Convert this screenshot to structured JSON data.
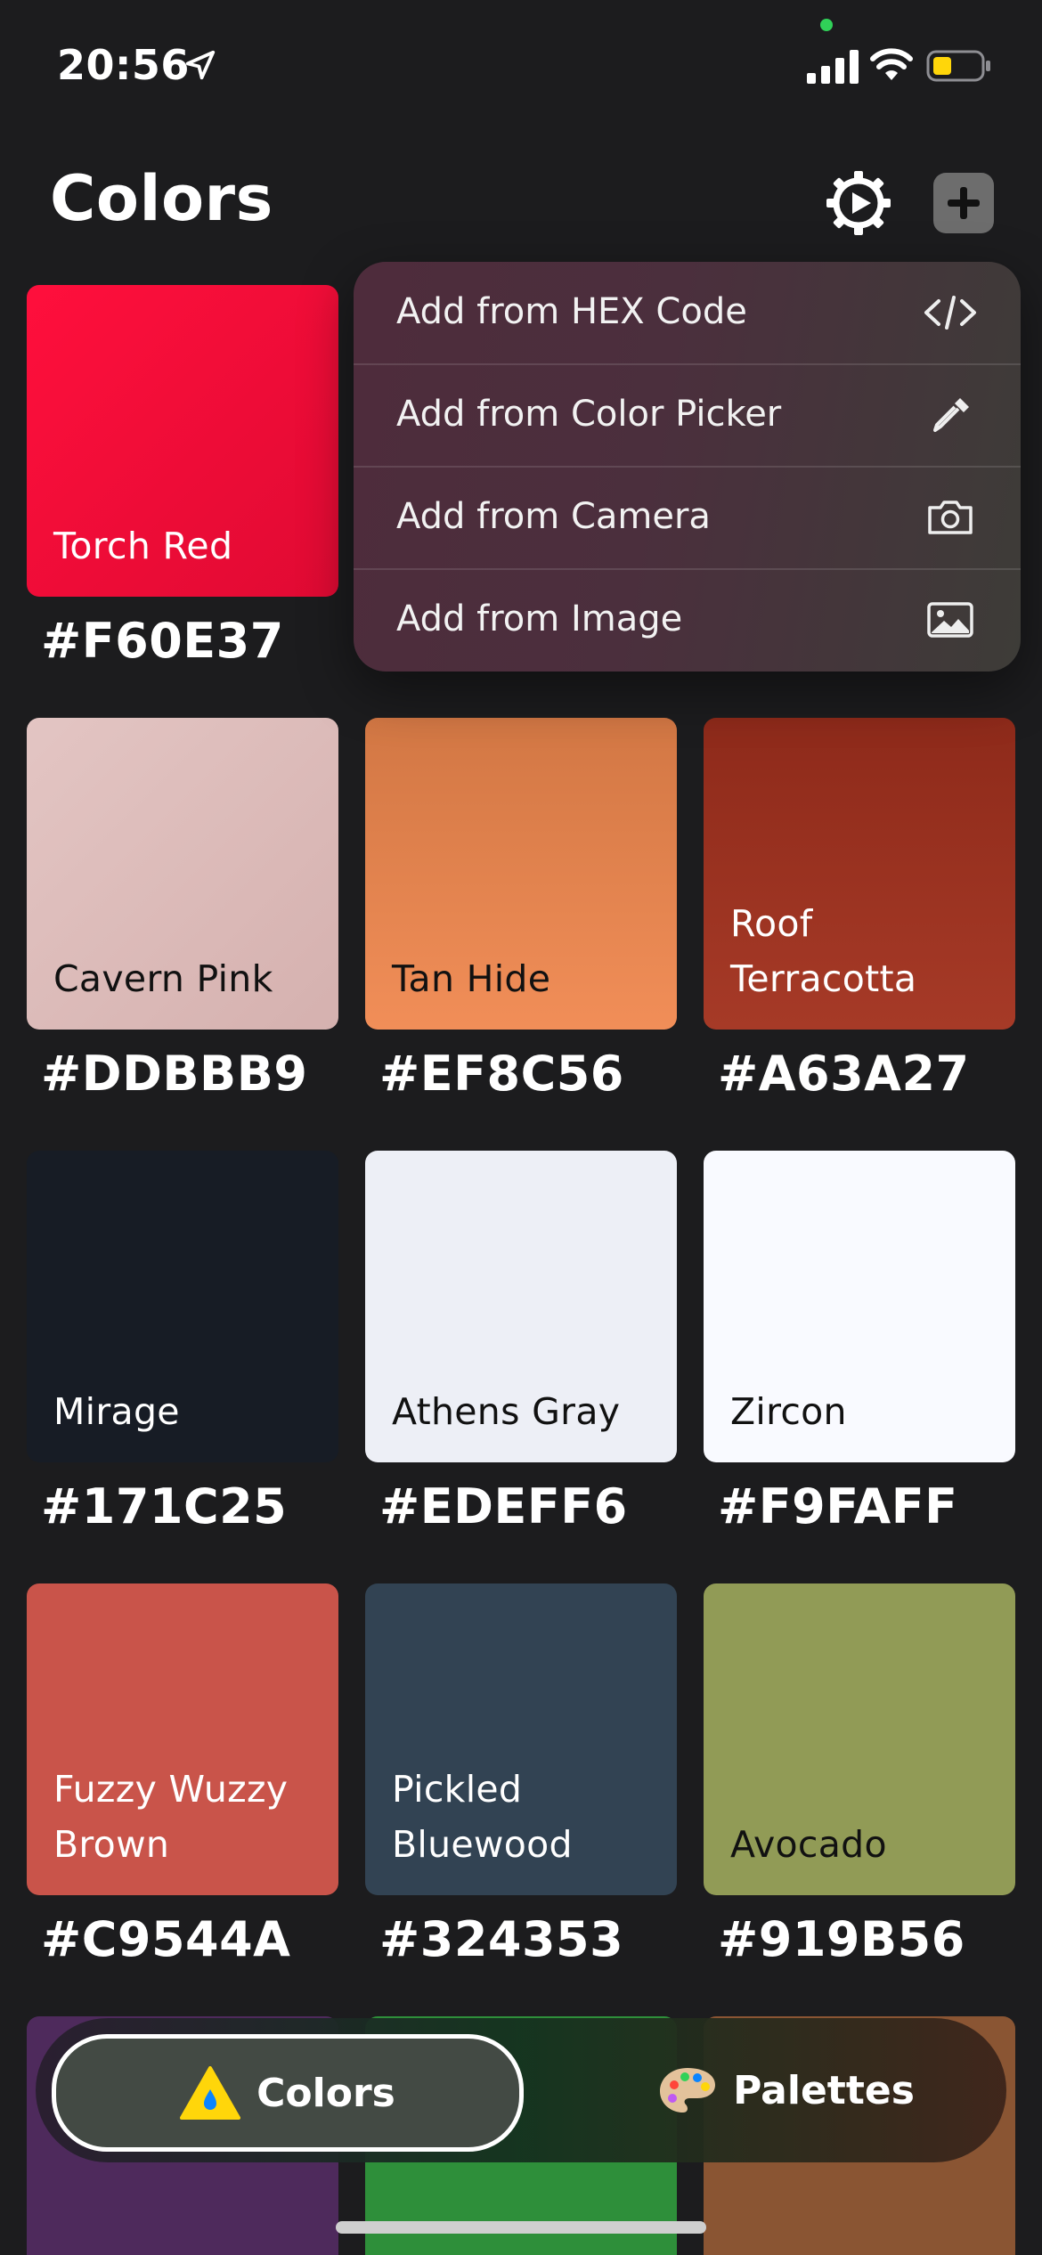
{
  "status_bar": {
    "time": "20:56"
  },
  "header": {
    "title": "Colors"
  },
  "add_menu": {
    "items": [
      {
        "label": "Add from HEX Code",
        "icon": "code-icon"
      },
      {
        "label": "Add from Color Picker",
        "icon": "eyedropper-icon"
      },
      {
        "label": "Add from Camera",
        "icon": "camera-icon"
      },
      {
        "label": "Add from Image",
        "icon": "image-icon"
      }
    ]
  },
  "colors": [
    {
      "name": "Torch Red",
      "hex": "#F60E37",
      "swatch": "#F60E37",
      "text_color": "#ffffff"
    },
    {
      "name": "Cavern Pink",
      "hex": "#DDBBB9",
      "swatch": "#DDBBB9",
      "text_color": "#111111"
    },
    {
      "name": "Tan Hide",
      "hex": "#EF8C56",
      "swatch": "#EF8C56",
      "text_color": "#111111"
    },
    {
      "name": "Roof Terracotta",
      "hex": "#A63A27",
      "swatch": "#A63A27",
      "text_color": "#ffffff"
    },
    {
      "name": "Mirage",
      "hex": "#171C25",
      "swatch": "#171C25",
      "text_color": "#ffffff"
    },
    {
      "name": "Athens Gray",
      "hex": "#EDEFF6",
      "swatch": "#EDEFF6",
      "text_color": "#111111"
    },
    {
      "name": "Zircon",
      "hex": "#F9FAFF",
      "swatch": "#F9FAFF",
      "text_color": "#111111"
    },
    {
      "name": "Fuzzy Wuzzy Brown",
      "hex": "#C9544A",
      "swatch": "#C9544A",
      "text_color": "#ffffff"
    },
    {
      "name": "Pickled Bluewood",
      "hex": "#324353",
      "swatch": "#324353",
      "text_color": "#ffffff"
    },
    {
      "name": "Avocado",
      "hex": "#919B56",
      "swatch": "#919B56",
      "text_color": "#111111"
    }
  ],
  "peek_swatches": [
    "#4E2A5C",
    "#2E8F3A",
    "#8A5533"
  ],
  "tabs": [
    {
      "label": "Colors",
      "icon": "drop-icon",
      "selected": true
    },
    {
      "label": "Palettes",
      "icon": "palette-icon",
      "selected": false
    }
  ]
}
